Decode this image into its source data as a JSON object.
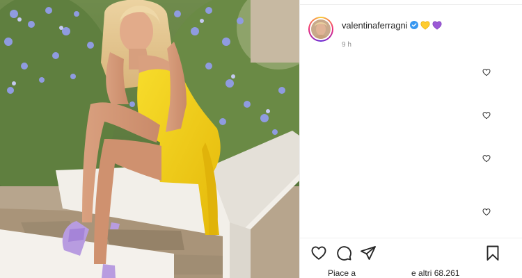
{
  "post": {
    "username": "valentinaferragni",
    "time_ago": "9 h",
    "likes_prefix": "Piace a",
    "likes_suffix": "e altri 68.261"
  },
  "icons": {
    "verified": "verified-badge-icon",
    "heart_yellow": "yellow-heart-emoji",
    "heart_purple": "purple-heart-emoji",
    "comment_like": "heart-outline-icon",
    "like": "heart-outline-icon",
    "comment": "comment-bubble-icon",
    "share": "paper-plane-icon",
    "save": "bookmark-icon"
  },
  "colors": {
    "verified": "#3897f0",
    "emoji_yellow": "#ffcc2f",
    "emoji_purple": "#9b59d6",
    "dress": "#f2cf14",
    "text": "#262626",
    "muted": "#8e8e8e"
  }
}
